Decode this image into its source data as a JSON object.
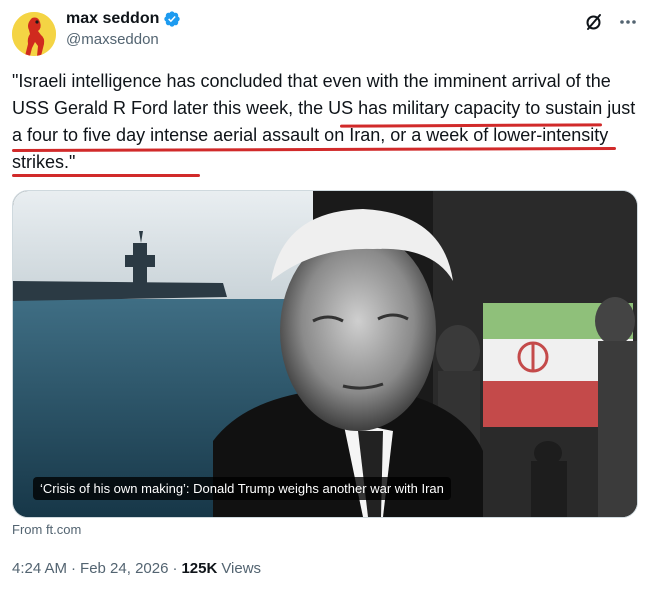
{
  "author": {
    "display_name": "max seddon",
    "handle": "@maxseddon",
    "verified": true,
    "avatar_icon": "red-figure-on-yellow-avatar"
  },
  "actions": {
    "grok_icon": "grok-slash-icon",
    "more_icon": "more-dots-icon"
  },
  "tweet": {
    "text_before": "\"Israeli intelligence has concluded that even with the imminent arrival of the USS Gerald R Ford later this week, ",
    "text_highlighted": "the US has military capacity to sustain just a four to five day intense aerial assault on Iran, or a week of lower-intensity strikes",
    "text_after": ".\"",
    "highlight_color": "#d12a2a"
  },
  "media": {
    "caption": "‘Crisis of his own making’: Donald Trump weighs another war with Iran",
    "source": "From ft.com"
  },
  "meta": {
    "time": "4:24 AM",
    "separator1": "·",
    "date": "Feb 24, 2026",
    "separator2": "·",
    "views_count": "125K",
    "views_label": "Views"
  },
  "colors": {
    "text_primary": "#0f1419",
    "text_secondary": "#536471",
    "verified_blue": "#1d9bf0"
  }
}
